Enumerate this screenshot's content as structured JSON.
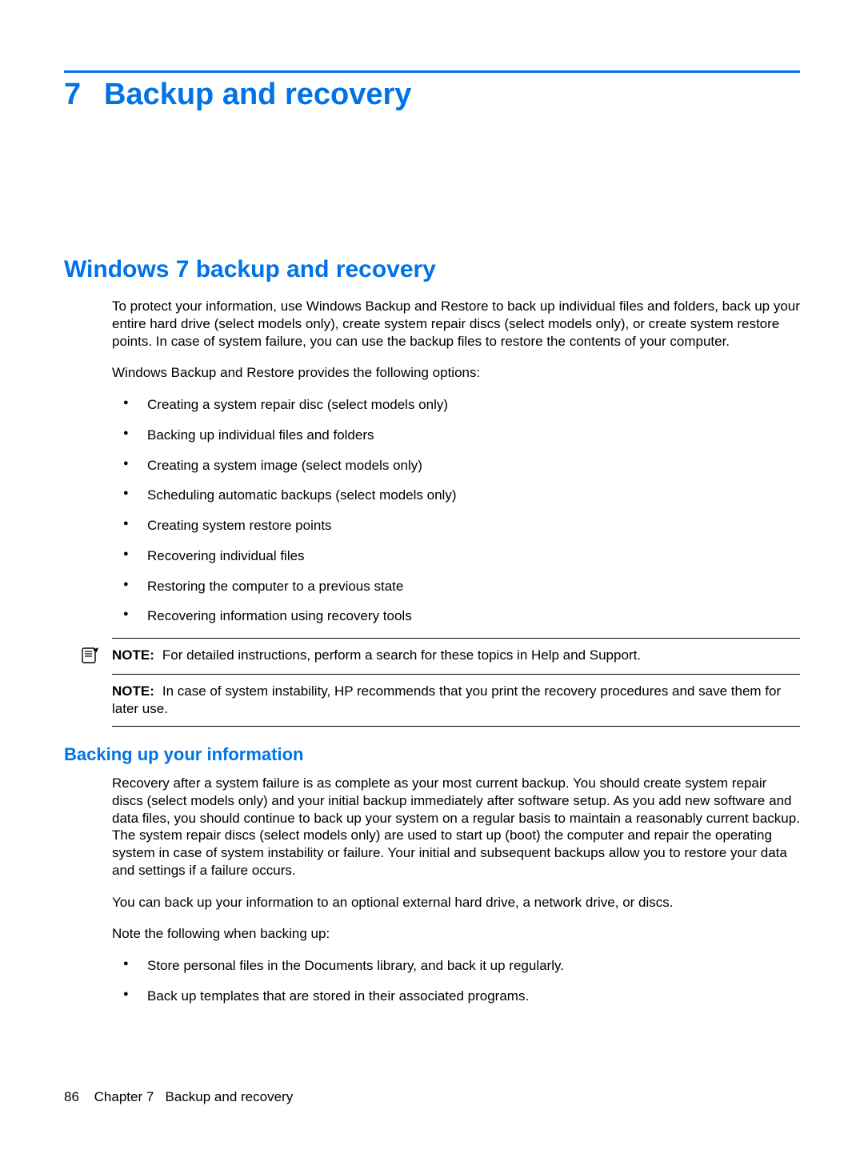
{
  "chapter": {
    "number": "7",
    "title": "Backup and recovery"
  },
  "section1": {
    "heading": "Windows 7 backup and recovery",
    "p1": "To protect your information, use Windows Backup and Restore to back up individual files and folders, back up your entire hard drive (select models only), create system repair discs (select models only), or create system restore points. In case of system failure, you can use the backup files to restore the contents of your computer.",
    "p2": "Windows Backup and Restore provides the following options:",
    "bullets": [
      "Creating a system repair disc (select models only)",
      "Backing up individual files and folders",
      "Creating a system image (select models only)",
      "Scheduling automatic backups (select models only)",
      "Creating system restore points",
      "Recovering individual files",
      "Restoring the computer to a previous state",
      "Recovering information using recovery tools"
    ],
    "note1": {
      "label": "NOTE:",
      "text": "For detailed instructions, perform a search for these topics in Help and Support."
    },
    "note2": {
      "label": "NOTE:",
      "text": "In case of system instability, HP recommends that you print the recovery procedures and save them for later use."
    }
  },
  "section2": {
    "heading": "Backing up your information",
    "p1": "Recovery after a system failure is as complete as your most current backup. You should create system repair discs (select models only) and your initial backup immediately after software setup. As you add new software and data files, you should continue to back up your system on a regular basis to maintain a reasonably current backup. The system repair discs (select models only) are used to start up (boot) the computer and repair the operating system in case of system instability or failure. Your initial and subsequent backups allow you to restore your data and settings if a failure occurs.",
    "p2": "You can back up your information to an optional external hard drive, a network drive, or discs.",
    "p3": "Note the following when backing up:",
    "bullets": [
      "Store personal files in the Documents library, and back it up regularly.",
      "Back up templates that are stored in their associated programs."
    ]
  },
  "footer": {
    "page": "86",
    "chapter_label": "Chapter 7",
    "chapter_title": "Backup and recovery"
  }
}
